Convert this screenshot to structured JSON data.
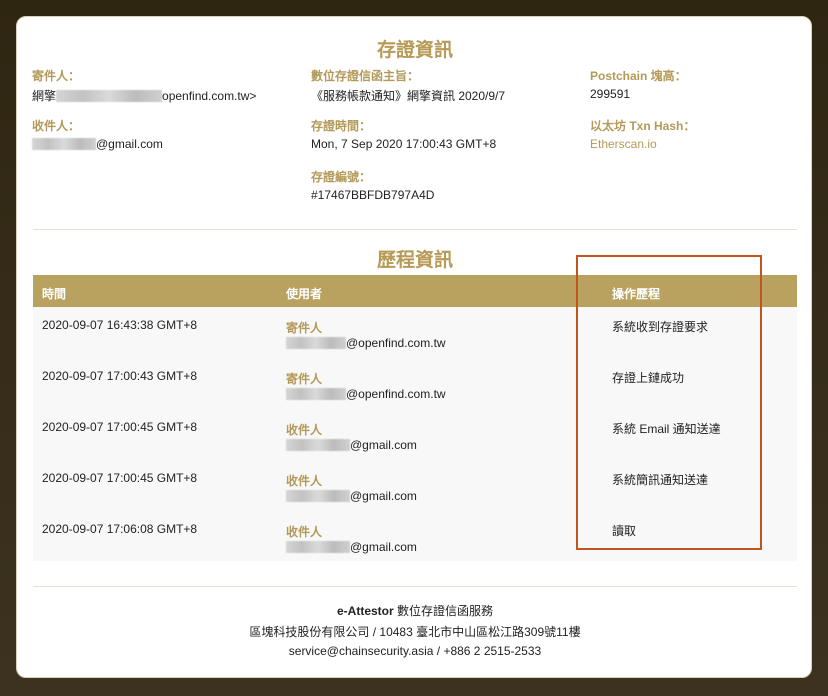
{
  "cert_info": {
    "title": "存證資訊",
    "sender_label": "寄件人：",
    "sender_prefix": "網擎",
    "sender_suffix": "openfind.com.tw>",
    "recipient_label": "收件人：",
    "recipient_suffix": "@gmail.com",
    "subject_label": "數位存證信函主旨：",
    "subject_value": "《服務帳款通知》網擎資訊 2020/9/7",
    "time_label": "存證時間：",
    "time_value": "Mon, 7 Sep 2020 17:00:43 GMT+8",
    "id_label": "存證編號：",
    "id_value": "#17467BBFDB797A4D",
    "block_label": "Postchain 塊高：",
    "block_value": "299591",
    "eth_label": "以太坊 Txn Hash：",
    "eth_value": "Etherscan.io"
  },
  "history": {
    "title": "歷程資訊",
    "columns": [
      "時間",
      "使用者",
      "操作歷程"
    ],
    "rows": [
      {
        "time": "2020-09-07 16:43:38 GMT+8",
        "role": "寄件人",
        "email_suffix": "@openfind.com.tw",
        "action": "系統收到存證要求"
      },
      {
        "time": "2020-09-07 17:00:43 GMT+8",
        "role": "寄件人",
        "email_suffix": "@openfind.com.tw",
        "action": "存證上鏈成功"
      },
      {
        "time": "2020-09-07 17:00:45 GMT+8",
        "role": "收件人",
        "email_suffix": "@gmail.com",
        "action": "系統 Email 通知送達"
      },
      {
        "time": "2020-09-07 17:00:45 GMT+8",
        "role": "收件人",
        "email_suffix": "@gmail.com",
        "action": "系統簡訊通知送達"
      },
      {
        "time": "2020-09-07 17:06:08 GMT+8",
        "role": "收件人",
        "email_suffix": "@gmail.com",
        "action": "讀取"
      }
    ]
  },
  "footer": {
    "service_name": "e-Attestor",
    "service_desc": " 數位存證信函服務",
    "company": "區塊科技股份有限公司 / 10483 臺北市中山區松江路309號11樓",
    "contact": "service@chainsecurity.asia / +886 2 2515-2533"
  },
  "colors": {
    "accent": "#b9a160",
    "highlight_box": "#c0561c"
  }
}
